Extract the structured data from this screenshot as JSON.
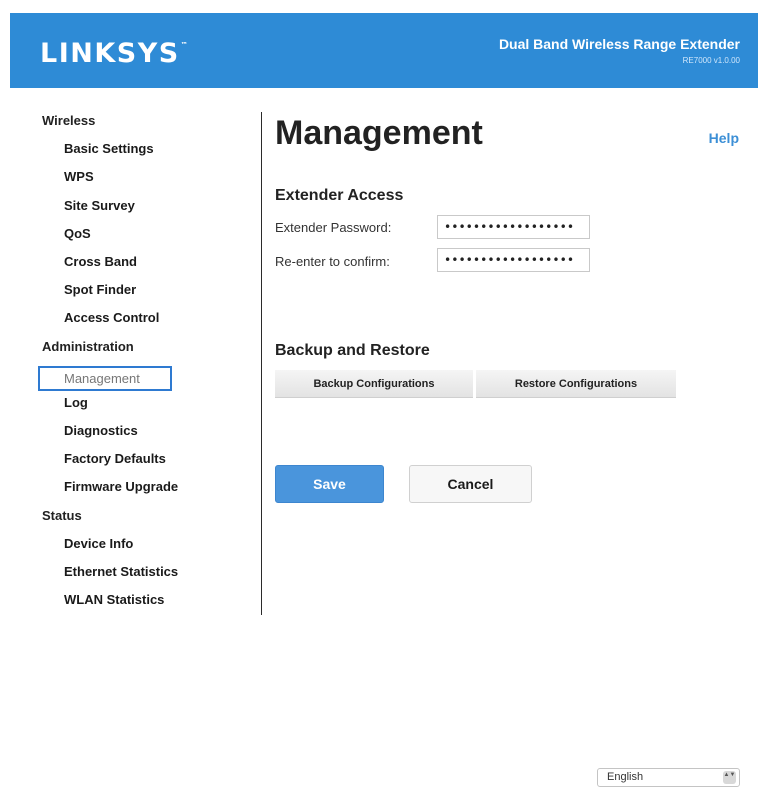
{
  "header": {
    "brand": "LINKSYS",
    "brand_tm": "™",
    "product_name": "Dual Band Wireless Range Extender",
    "product_model": "RE7000 v1.0.00"
  },
  "sidebar": {
    "wireless": {
      "label": "Wireless",
      "items": [
        "Basic Settings",
        "WPS",
        "Site Survey",
        "QoS",
        "Cross Band",
        "Spot Finder",
        "Access Control"
      ]
    },
    "administration": {
      "label": "Administration",
      "items": [
        "Management",
        "Log",
        "Diagnostics",
        "Factory Defaults",
        "Firmware Upgrade"
      ]
    },
    "status": {
      "label": "Status",
      "items": [
        "Device Info",
        "Ethernet Statistics",
        "WLAN Statistics"
      ]
    },
    "active_item": "Management"
  },
  "main": {
    "title": "Management",
    "help": "Help",
    "extender_access": {
      "title": "Extender Access",
      "password_label": "Extender Password:",
      "password_value": "••••••••••••••••••",
      "confirm_label": "Re-enter to confirm:",
      "confirm_value": "••••••••••••••••••"
    },
    "backup_restore": {
      "title": "Backup and Restore",
      "backup_label": "Backup Configurations",
      "restore_label": "Restore Configurations"
    },
    "save_label": "Save",
    "cancel_label": "Cancel"
  },
  "footer": {
    "language": "English",
    "language_arrows": "▲▼"
  },
  "colors": {
    "header_bg": "#2e8bd6",
    "accent": "#3c8fd6",
    "active_border": "#2e7ad1",
    "save_button": "#4a95dc"
  }
}
